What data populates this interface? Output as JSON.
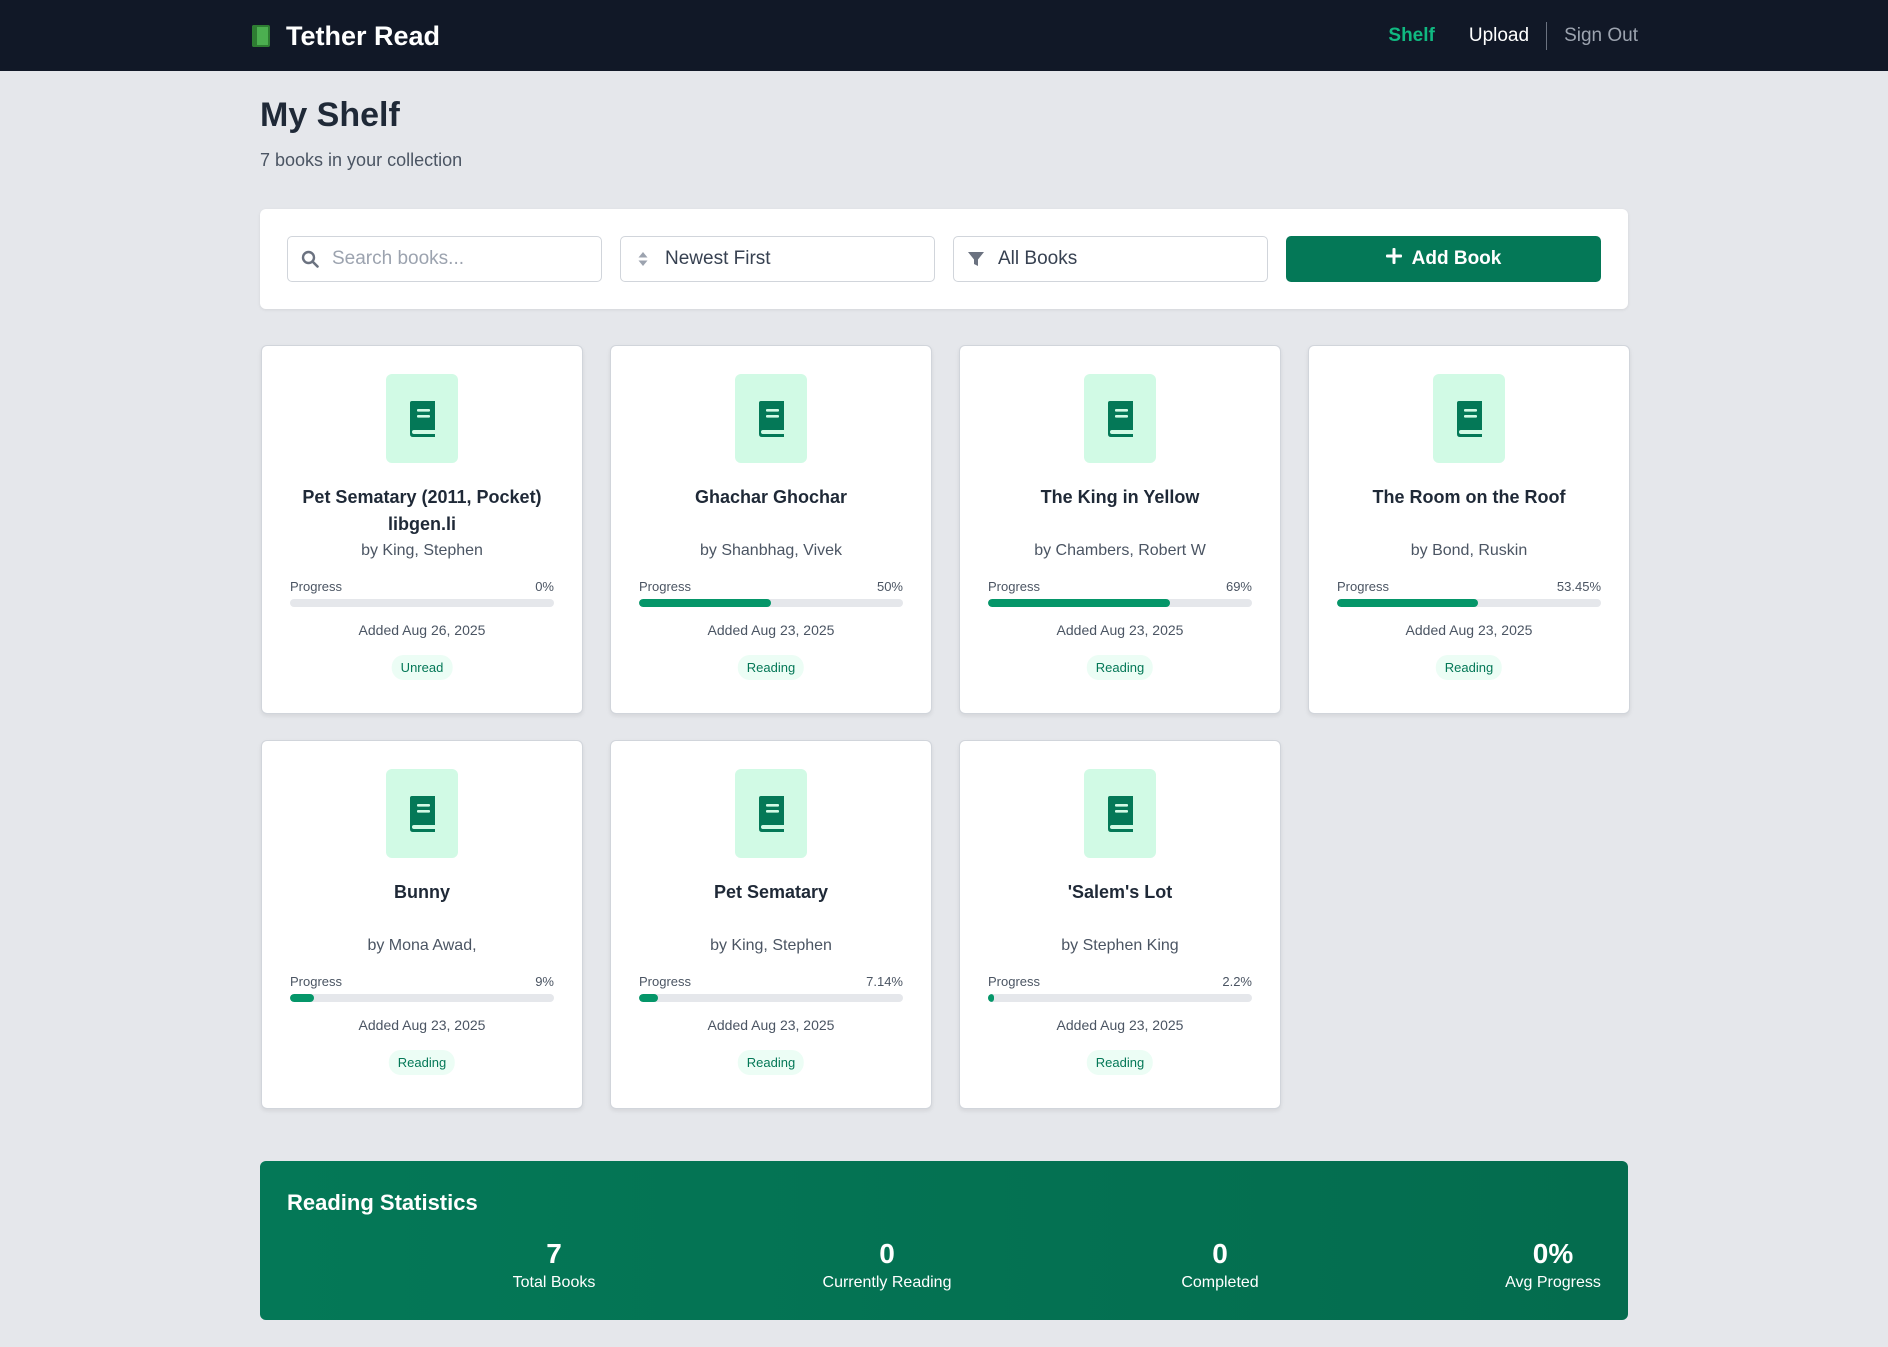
{
  "app": {
    "title": "Tether Read",
    "brand_icon": "green-book-icon"
  },
  "nav": {
    "shelf": "Shelf",
    "upload": "Upload",
    "signout": "Sign Out"
  },
  "page": {
    "title": "My Shelf",
    "subtitle": "7 books in your collection"
  },
  "toolbar": {
    "search_placeholder": "Search books...",
    "sort_label": "Newest First",
    "filter_label": "All Books",
    "add_label": "Add Book"
  },
  "books": [
    {
      "title": "Pet Sematary (2011, Pocket) libgen.li",
      "author": "by King, Stephen",
      "progress_label": "Progress",
      "progress_text": "0%",
      "progress": 0,
      "added": "Added Aug 26, 2025",
      "status": "Unread"
    },
    {
      "title": "Ghachar Ghochar",
      "author": "by Shanbhag, Vivek",
      "progress_label": "Progress",
      "progress_text": "50%",
      "progress": 50,
      "added": "Added Aug 23, 2025",
      "status": "Reading"
    },
    {
      "title": "The King in Yellow",
      "author": "by Chambers, Robert W",
      "progress_label": "Progress",
      "progress_text": "69%",
      "progress": 69,
      "added": "Added Aug 23, 2025",
      "status": "Reading"
    },
    {
      "title": "The Room on the Roof",
      "author": "by Bond, Ruskin",
      "progress_label": "Progress",
      "progress_text": "53.45%",
      "progress": 53.45,
      "added": "Added Aug 23, 2025",
      "status": "Reading"
    },
    {
      "title": "Bunny",
      "author": "by Mona Awad,",
      "progress_label": "Progress",
      "progress_text": "9%",
      "progress": 9,
      "added": "Added Aug 23, 2025",
      "status": "Reading"
    },
    {
      "title": "Pet Sematary",
      "author": "by King, Stephen",
      "progress_label": "Progress",
      "progress_text": "7.14%",
      "progress": 7.14,
      "added": "Added Aug 23, 2025",
      "status": "Reading"
    },
    {
      "title": "'Salem's Lot",
      "author": "by Stephen King",
      "progress_label": "Progress",
      "progress_text": "2.2%",
      "progress": 2.2,
      "added": "Added Aug 23, 2025",
      "status": "Reading"
    }
  ],
  "stats": {
    "title": "Reading Statistics",
    "items": [
      {
        "value": "7",
        "label": "Total Books"
      },
      {
        "value": "0",
        "label": "Currently Reading"
      },
      {
        "value": "0",
        "label": "Completed"
      },
      {
        "value": "0%",
        "label": "Avg Progress"
      }
    ]
  },
  "colors": {
    "header_bg": "#111827",
    "accent": "#047857",
    "accent_bright": "#10b981",
    "cover_tile": "#d1fae5",
    "page_bg": "#e5e7eb"
  }
}
